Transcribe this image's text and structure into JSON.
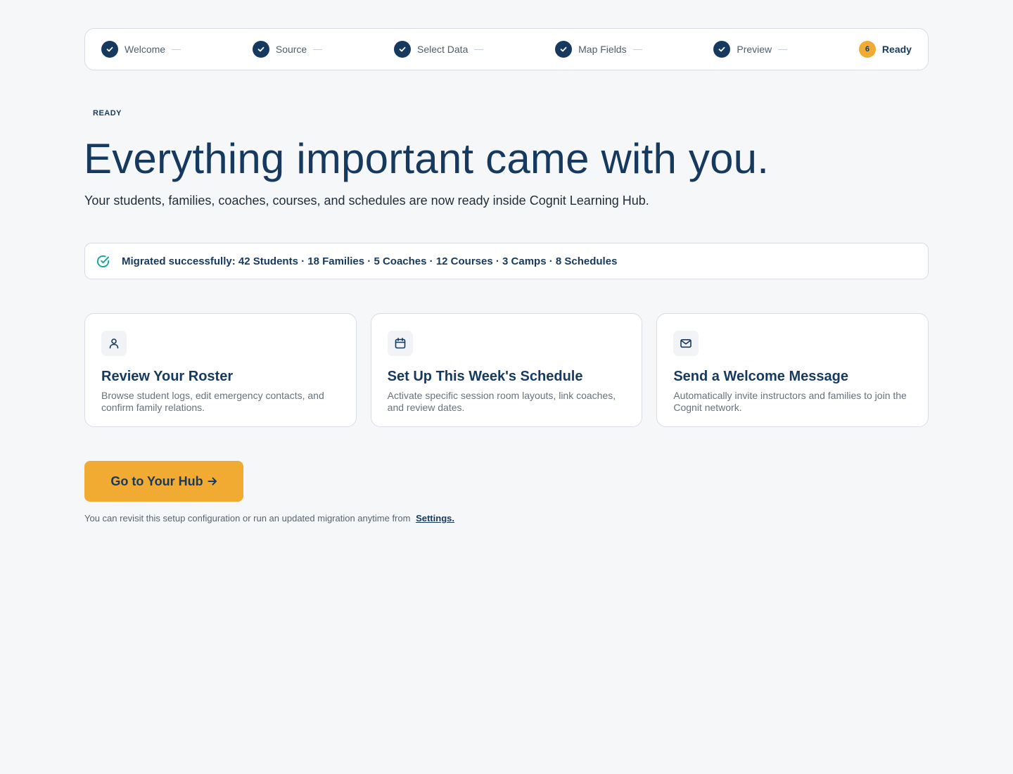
{
  "stepper": {
    "steps": [
      {
        "label": "Welcome",
        "state": "done"
      },
      {
        "label": "Source",
        "state": "done"
      },
      {
        "label": "Select Data",
        "state": "done"
      },
      {
        "label": "Map Fields",
        "state": "done"
      },
      {
        "label": "Preview",
        "state": "done"
      },
      {
        "label": "Ready",
        "state": "current",
        "number": "6"
      }
    ]
  },
  "hero": {
    "eyebrow": "READY",
    "title": "Everything important came with you.",
    "subtitle": "Your students, families, coaches, courses, and schedules are now ready inside Cognit Learning Hub."
  },
  "banner": {
    "icon": "check-circle-icon",
    "text": "Migrated successfully: 42 Students · 18 Families · 5 Coaches · 12 Courses · 3 Camps · 8 Schedules"
  },
  "cards": [
    {
      "icon": "user-icon",
      "title": "Review Your Roster",
      "description": "Browse student logs, edit emergency contacts, and confirm family relations."
    },
    {
      "icon": "calendar-icon",
      "title": "Set Up This Week's Schedule",
      "description": "Activate specific session room layouts, link coaches, and review dates."
    },
    {
      "icon": "mail-icon",
      "title": "Send a Welcome Message",
      "description": "Automatically invite instructors and families to join the Cognit network."
    }
  ],
  "cta": {
    "label": "Go to Your Hub",
    "icon": "arrow-right-icon"
  },
  "footnote": {
    "text": "You can revisit this setup configuration or run an updated migration anytime from",
    "link": "Settings."
  },
  "colors": {
    "navy": "#163a5f",
    "accent": "#f1ab32",
    "success": "#1aa39a",
    "background": "#f6f7f9"
  }
}
